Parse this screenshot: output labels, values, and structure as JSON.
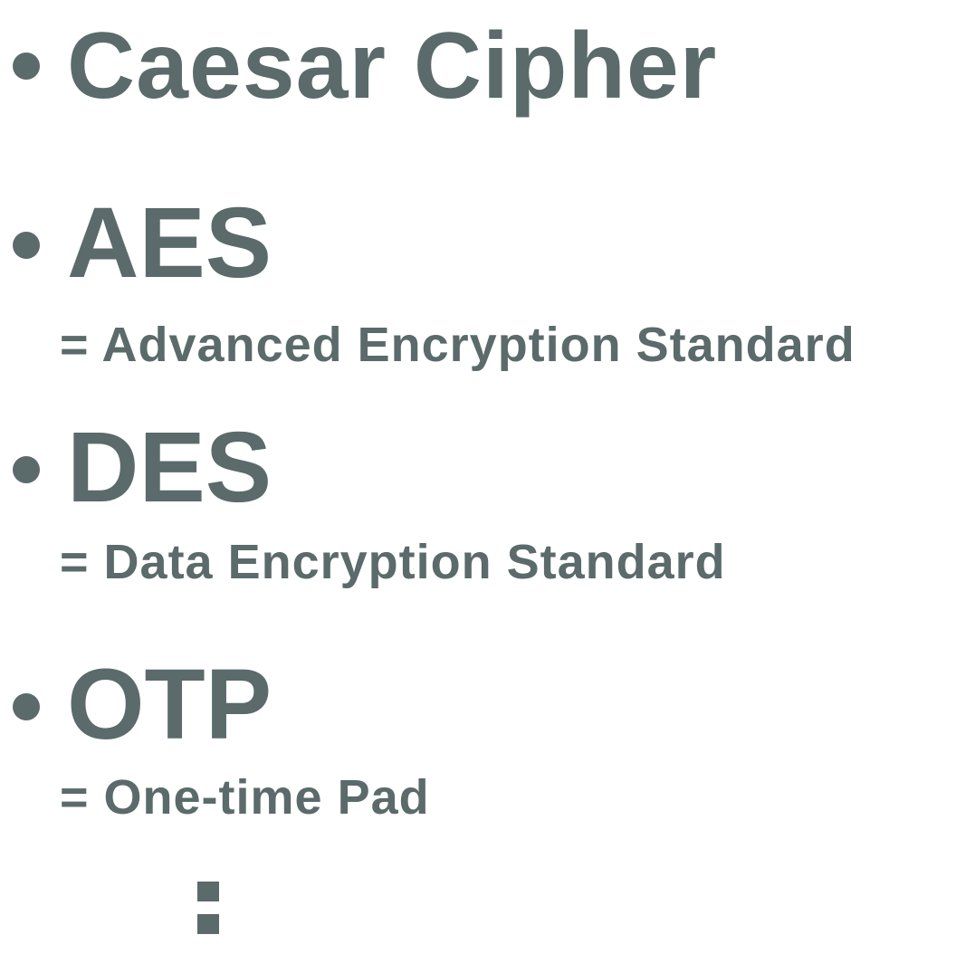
{
  "items": [
    {
      "term": "Caesar Cipher",
      "expansion": ""
    },
    {
      "term": "AES",
      "expansion": "= Advanced Encryption Standard"
    },
    {
      "term": "DES",
      "expansion": "= Data Encryption Standard"
    },
    {
      "term": "OTP",
      "expansion": "= One-time Pad"
    }
  ],
  "continuation": "⋮",
  "icons": {
    "bullet": "bullet-dot-icon",
    "continuation": "vertical-ellipsis-icon"
  },
  "colors": {
    "text": "#5b6a6a",
    "background": "#ffffff"
  }
}
